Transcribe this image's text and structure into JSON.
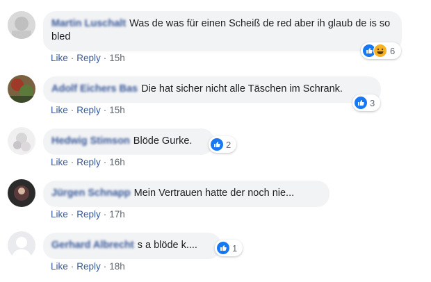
{
  "comments": [
    {
      "author": "Martin Luschalt",
      "text": "Was de was für einen Scheiß de red aber ih glaub de is so bled",
      "like_label": "Like",
      "reply_label": "Reply",
      "time": "15h",
      "reactions": [
        "like",
        "haha"
      ],
      "reaction_count": "6"
    },
    {
      "author": "Adolf Eichers Bas",
      "text": "Die hat sicher nicht alle Täschen im Schrank.",
      "like_label": "Like",
      "reply_label": "Reply",
      "time": "15h",
      "reactions": [
        "like"
      ],
      "reaction_count": "3"
    },
    {
      "author": "Hedwig Stimson",
      "text": "Blöde Gurke.",
      "like_label": "Like",
      "reply_label": "Reply",
      "time": "16h",
      "reactions": [
        "like"
      ],
      "reaction_count": "2"
    },
    {
      "author": "Jürgen Schnapp",
      "text": "Mein Vertrauen hatte der noch nie...",
      "like_label": "Like",
      "reply_label": "Reply",
      "time": "17h",
      "reactions": [],
      "reaction_count": ""
    },
    {
      "author": "Gerhard Albrecht",
      "text": "s a blöde k....",
      "like_label": "Like",
      "reply_label": "Reply",
      "time": "18h",
      "reactions": [
        "like"
      ],
      "reaction_count": "1"
    }
  ],
  "colors": {
    "link": "#385898",
    "bubble": "#f2f3f5",
    "like_blue": "#1877f2",
    "haha_yellow": "#f7b125"
  }
}
